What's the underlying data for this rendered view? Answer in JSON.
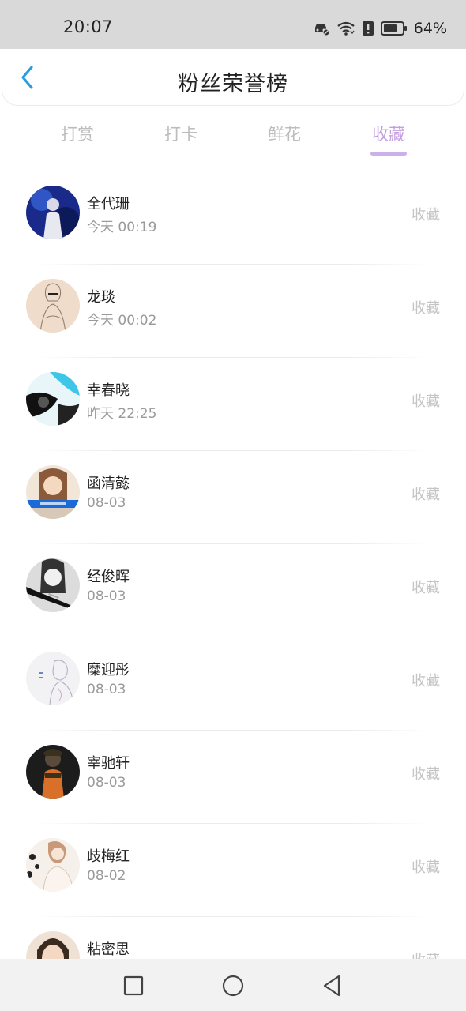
{
  "status_bar": {
    "time": "20:07",
    "battery_percent": "64%",
    "icons": [
      "car-icon",
      "wifi-icon",
      "alert-icon",
      "battery-icon"
    ]
  },
  "header": {
    "title": "粉丝荣誉榜",
    "back_icon": "chevron-left-icon",
    "accent_color": "#2a9de0"
  },
  "tabs": [
    {
      "label": "打赏",
      "active": false
    },
    {
      "label": "打卡",
      "active": false
    },
    {
      "label": "鲜花",
      "active": false
    },
    {
      "label": "收藏",
      "active": true
    }
  ],
  "active_tab_color": "#c49ee0",
  "list": {
    "items": [
      {
        "name": "全代珊",
        "time": "今天 00:19",
        "action": "收藏"
      },
      {
        "name": "龙琰",
        "time": "今天 00:02",
        "action": "收藏"
      },
      {
        "name": "幸春晓",
        "time": "昨天 22:25",
        "action": "收藏"
      },
      {
        "name": "函清懿",
        "time": "08-03",
        "action": "收藏"
      },
      {
        "name": "经俊晖",
        "time": "08-03",
        "action": "收藏"
      },
      {
        "name": "糜迎彤",
        "time": "08-03",
        "action": "收藏"
      },
      {
        "name": "宰驰轩",
        "time": "08-03",
        "action": "收藏"
      },
      {
        "name": "歧梅红",
        "time": "08-02",
        "action": "收藏"
      },
      {
        "name": "粘密思",
        "time": "",
        "action": "收藏"
      }
    ]
  },
  "nav_bar": {
    "buttons": [
      "square-recent-icon",
      "circle-home-icon",
      "triangle-back-icon"
    ]
  }
}
